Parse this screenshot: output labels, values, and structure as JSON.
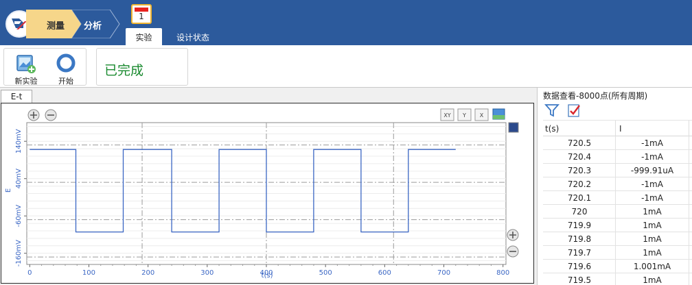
{
  "header": {
    "breadcrumbs": [
      "测量",
      "分析"
    ],
    "calendar_day": "1",
    "tabs": [
      "实验",
      "设计状态"
    ],
    "colors": {
      "bar": "#2c5a9c",
      "active_crumb": "#f6d68a",
      "status_text": "#1a8a2f"
    }
  },
  "ribbon": {
    "new_experiment": "新实验",
    "start": "开始",
    "status": "已完成"
  },
  "chart_pane": {
    "tab": "E-t",
    "toolbar_icons": [
      "zoom-in-icon",
      "zoom-out-icon",
      "fit-xy-icon",
      "fit-y-icon",
      "fit-x-icon",
      "image-icon"
    ]
  },
  "chart_data": {
    "type": "line",
    "xlabel": "t(s)",
    "ylabel": "E",
    "xlim": [
      -5,
      805
    ],
    "ylim": [
      -190,
      190
    ],
    "x_ticks": [
      0,
      100,
      200,
      300,
      400,
      500,
      600,
      700,
      800
    ],
    "y_ticks": [
      140,
      40,
      -60,
      -160
    ],
    "y_tick_labels": [
      "140mV",
      "40mV",
      "-60mV",
      "-160mV"
    ],
    "grid": true,
    "series": [
      {
        "color": "#3a66c4",
        "x": [
          0,
          78,
          78,
          158,
          158,
          240,
          240,
          320,
          320,
          400,
          400,
          480,
          480,
          560,
          560,
          640,
          640,
          720
        ],
        "y": [
          118,
          118,
          -103,
          -103,
          118,
          118,
          -103,
          -103,
          118,
          118,
          -103,
          -103,
          118,
          118,
          -103,
          -103,
          118,
          118
        ]
      }
    ]
  },
  "data_view": {
    "title": "数据查看-8000点(所有周期)",
    "columns": [
      "t(s)",
      "I"
    ],
    "rows": [
      [
        "720.5",
        "-1mA"
      ],
      [
        "720.4",
        "-1mA"
      ],
      [
        "720.3",
        "-999.91uA"
      ],
      [
        "720.2",
        "-1mA"
      ],
      [
        "720.1",
        "-1mA"
      ],
      [
        "720",
        "1mA"
      ],
      [
        "719.9",
        "1mA"
      ],
      [
        "719.8",
        "1mA"
      ],
      [
        "719.7",
        "1mA"
      ],
      [
        "719.6",
        "1.001mA"
      ],
      [
        "719.5",
        "1mA"
      ]
    ]
  }
}
